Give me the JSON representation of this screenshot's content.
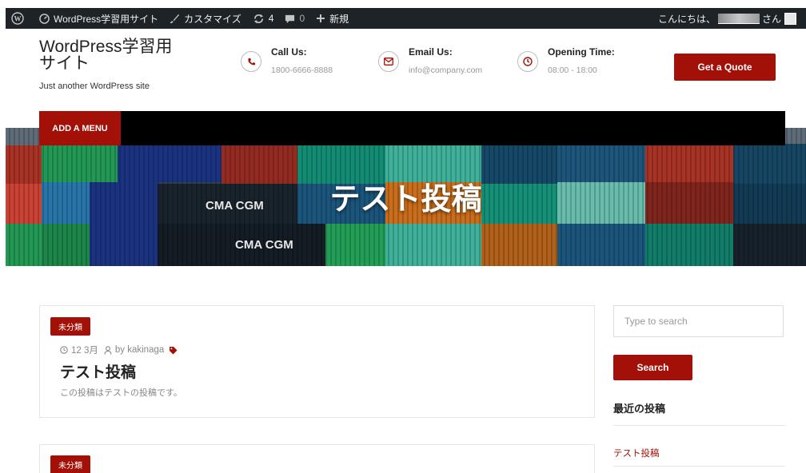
{
  "admin_bar": {
    "site_name": "WordPress学習用サイト",
    "customize": "カスタマイズ",
    "updates_count": "4",
    "comments_count": "0",
    "new_label": "新規",
    "greeting": "こんにちは、",
    "greeting_suffix": "さん"
  },
  "header": {
    "site_title": "WordPress学習用サイト",
    "tagline": "Just another WordPress site",
    "contacts": [
      {
        "label": "Call Us:",
        "value": "1800-6666-8888",
        "icon": "phone-icon"
      },
      {
        "label": "Email Us:",
        "value": "info@company.com",
        "icon": "mail-icon"
      },
      {
        "label": "Opening Time:",
        "value": "08:00 - 18:00",
        "icon": "clock-icon"
      }
    ],
    "cta_label": "Get a Quote"
  },
  "menu": {
    "add_menu_label": "ADD A MENU"
  },
  "banner": {
    "title": "テスト投稿",
    "image_text_1": "CMA CGM",
    "image_text_2": "CMA CGM"
  },
  "posts": [
    {
      "category": "未分類",
      "date": "12 3月",
      "author": "by kakinaga",
      "title": "テスト投稿",
      "excerpt": "この投稿はテストの投稿です。"
    },
    {
      "category": "未分類"
    }
  ],
  "sidebar": {
    "search_placeholder": "Type to search",
    "search_button": "Search",
    "recent_title": "最近の投稿",
    "recent_posts": [
      "テスト投稿"
    ]
  },
  "colors": {
    "accent": "#a31007",
    "admin_bar": "#1d2327",
    "menu_bar": "#000000"
  }
}
